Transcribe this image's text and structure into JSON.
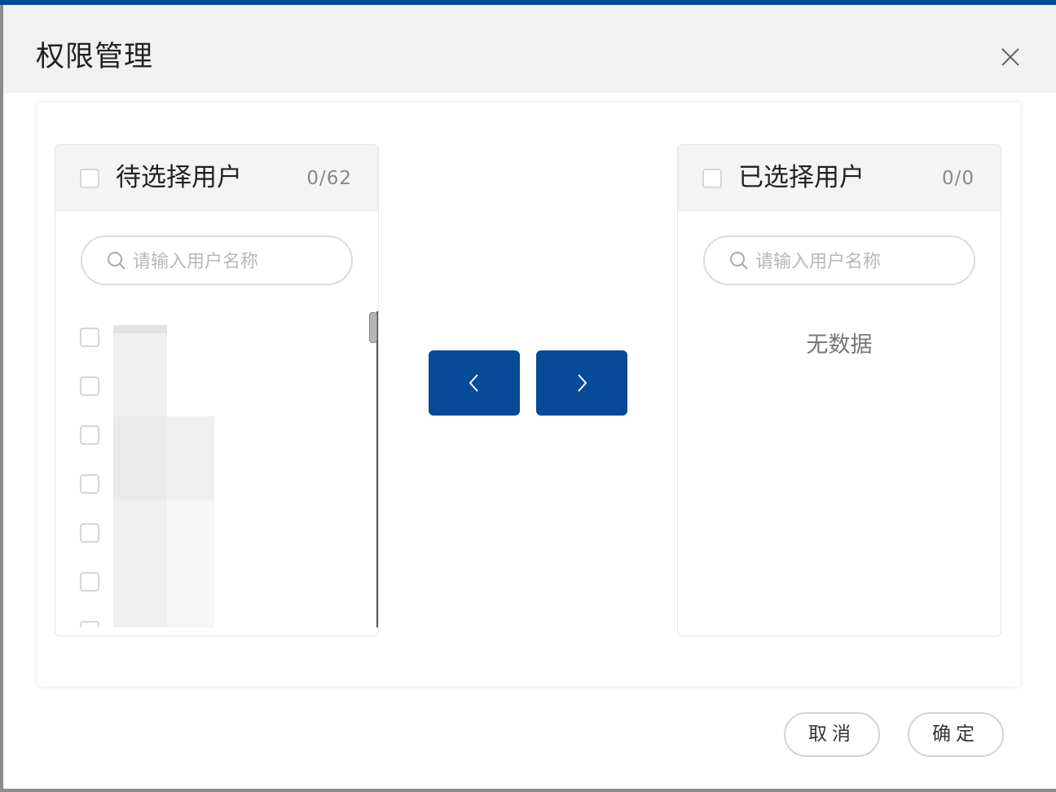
{
  "dialog": {
    "title": "权限管理",
    "close_icon": "close-icon"
  },
  "source_list": {
    "title": "待选择用户",
    "count": "0/62",
    "search_placeholder": "请输入用户名称",
    "rows": [
      {
        "checked": false
      },
      {
        "checked": false
      },
      {
        "checked": false
      },
      {
        "checked": false
      },
      {
        "checked": false
      },
      {
        "checked": false
      },
      {
        "checked": false
      }
    ]
  },
  "target_list": {
    "title": "已选择用户",
    "count": "0/0",
    "search_placeholder": "请输入用户名称",
    "empty_text": "无数据"
  },
  "transfer_buttons": {
    "to_left_icon": "chevron-left-icon",
    "to_right_icon": "chevron-right-icon"
  },
  "footer": {
    "cancel_label": "取消",
    "confirm_label": "确定"
  },
  "colors": {
    "primary": "#064a98",
    "header_bg": "#f1f1f1"
  }
}
